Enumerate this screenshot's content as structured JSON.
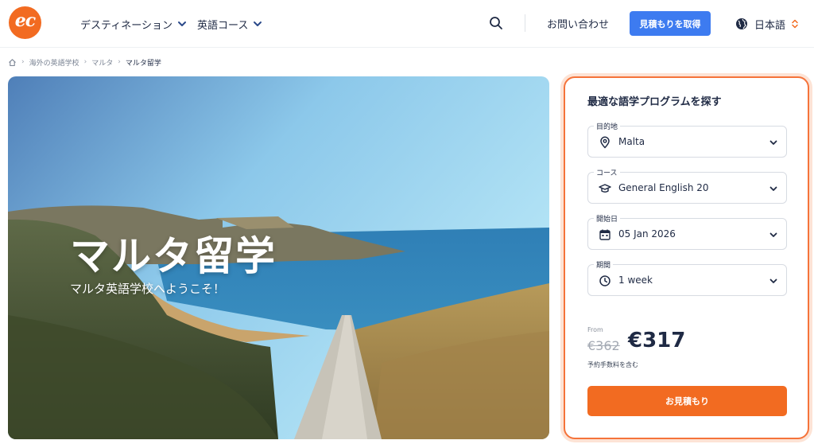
{
  "brand": {
    "logo_text": "ec",
    "accent": "#f26b21",
    "link_blue": "#3d7bf0"
  },
  "nav": {
    "items": [
      {
        "label": "デスティネーション",
        "icon": "chevron-down-icon"
      },
      {
        "label": "英語コース",
        "icon": "chevron-down-icon"
      }
    ],
    "search_icon": "search-icon",
    "contact_label": "お問い合わせ",
    "quote_button": "見積もりを取得",
    "language": {
      "label": "日本語",
      "icon": "globe-icon"
    }
  },
  "breadcrumb": {
    "home_icon": "home-icon",
    "items": [
      "海外の英語学校",
      "マルタ"
    ],
    "current": "マルタ留学"
  },
  "hero": {
    "title": "マルタ留学",
    "subtitle": "マルタ英語学校へようこそ！"
  },
  "finder": {
    "title": "最適な語学プログラムを探す",
    "fields": [
      {
        "label": "目的地",
        "value": "Malta",
        "icon": "map-pin-icon"
      },
      {
        "label": "コース",
        "value": "General English 20",
        "icon": "graduation-cap-icon"
      },
      {
        "label": "開始日",
        "value": "05 Jan 2026",
        "icon": "calendar-icon"
      },
      {
        "label": "期間",
        "value": "1 week",
        "icon": "clock-icon"
      }
    ],
    "price": {
      "from_label": "From",
      "old": "€362",
      "new": "€317",
      "note": "予約手数料を含む"
    },
    "cta": "お見積もり"
  }
}
